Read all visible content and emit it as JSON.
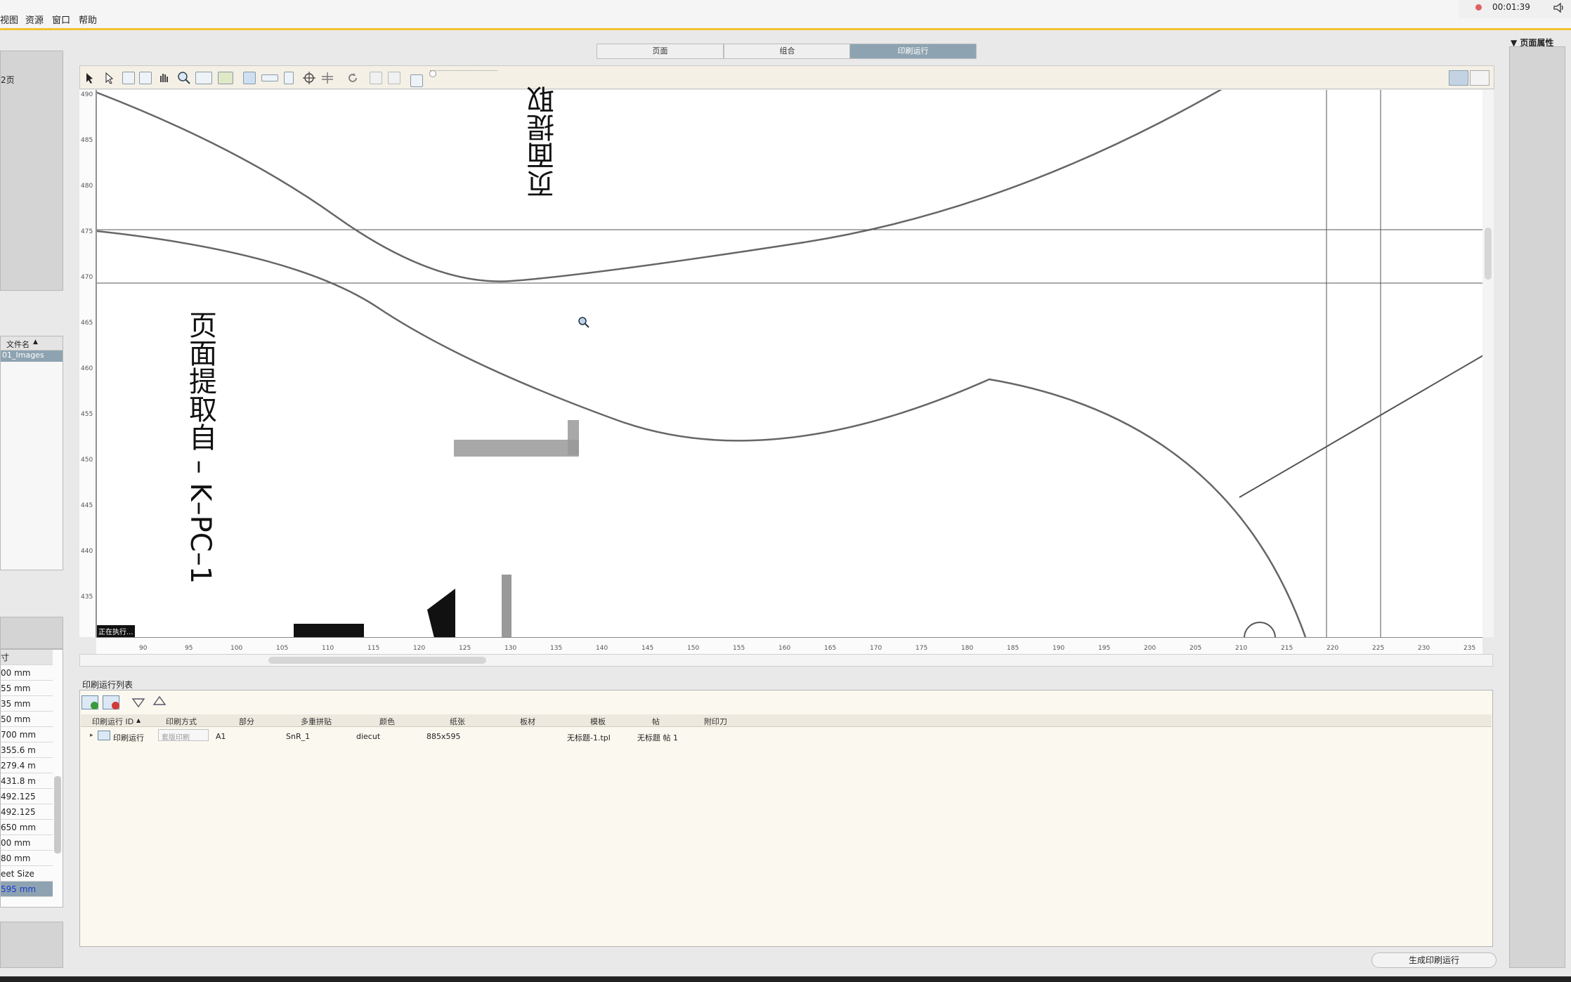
{
  "menu": {
    "items": [
      "视图",
      "资源",
      "窗口",
      "帮助"
    ]
  },
  "recorder": {
    "time": "00:01:39"
  },
  "tabs": [
    {
      "label": "页面",
      "active": false
    },
    {
      "label": "组合",
      "active": false
    },
    {
      "label": "印刷运行",
      "active": true
    }
  ],
  "right_panel": {
    "title": "▼ 页面属性"
  },
  "left": {
    "top_label": "2页",
    "file_header": "文件名",
    "file_row": "01_Images",
    "props_header": "寸",
    "props": [
      "00 mm",
      "55 mm",
      "35 mm",
      "50 mm",
      "700 mm",
      "355.6 m",
      "279.4 m",
      "431.8 m",
      "492.125",
      "492.125",
      "650 mm",
      "00 mm",
      "80 mm",
      "eet Size",
      "595 mm"
    ]
  },
  "canvas": {
    "text_top": "页面提取",
    "text_left": "页面提取自 – K–PC–1",
    "status": "正在执行..."
  },
  "ruler": {
    "x": [
      "90",
      "95",
      "100",
      "105",
      "110",
      "115",
      "120",
      "125",
      "130",
      "135",
      "140",
      "145",
      "150",
      "155",
      "160",
      "165",
      "170",
      "175",
      "180",
      "185",
      "190",
      "195",
      "200",
      "205",
      "210",
      "215",
      "220",
      "225",
      "230",
      "235"
    ],
    "y": [
      "490",
      "485",
      "480",
      "475",
      "470",
      "465",
      "460",
      "455",
      "450",
      "445",
      "440",
      "435"
    ]
  },
  "print_list": {
    "title": "印刷运行列表",
    "columns": [
      "印刷运行 ID",
      "印刷方式",
      "部分",
      "多重拼贴",
      "颜色",
      "纸张",
      "板材",
      "模板",
      "帖",
      "附印刀"
    ],
    "rows": [
      {
        "id": "印刷运行",
        "method": "套版印刷",
        "part": "A1",
        "snr": "SnR_1",
        "color": "diecut",
        "paper": "885x595",
        "plate": "",
        "template": "无标题-1.tpl",
        "sig": "无标题 帖 1",
        "extra": ""
      }
    ]
  },
  "footer": {
    "generate_button": "生成印刷运行"
  }
}
